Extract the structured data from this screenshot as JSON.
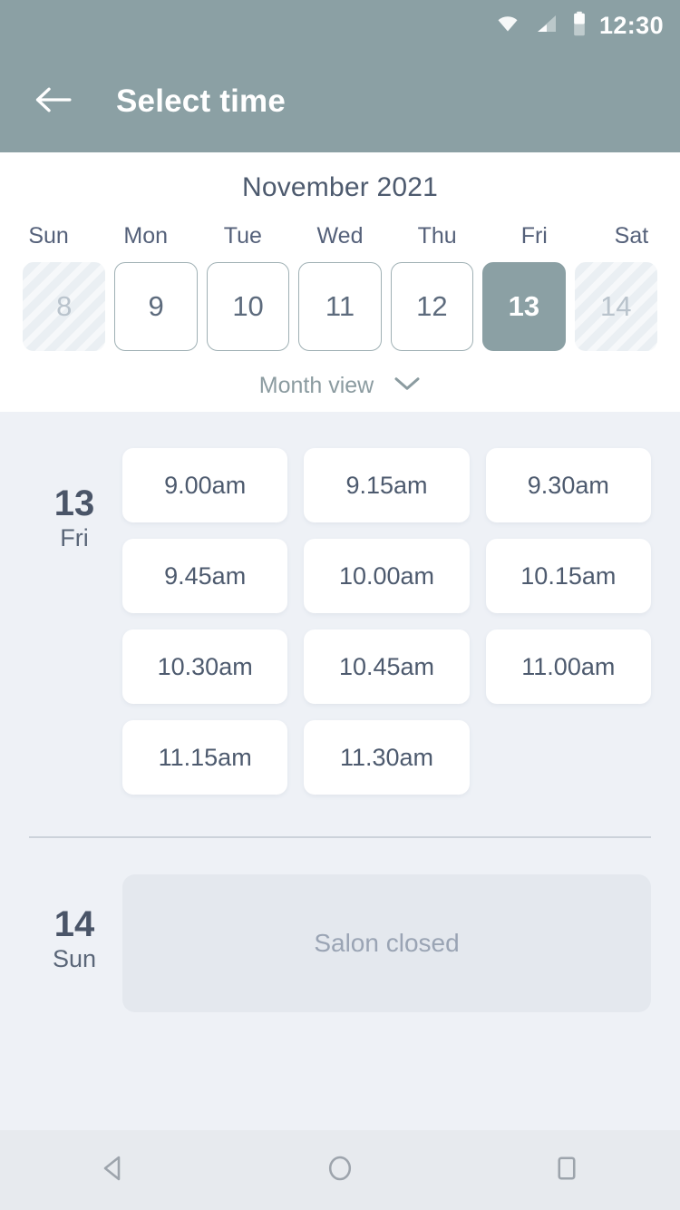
{
  "status_bar": {
    "time": "12:30",
    "icons": [
      "wifi-icon",
      "signal-icon",
      "battery-icon"
    ]
  },
  "app_bar": {
    "back_icon": "back-arrow-icon",
    "title": "Select time"
  },
  "calendar": {
    "month_title": "November 2021",
    "day_of_week_headers": [
      "Sun",
      "Mon",
      "Tue",
      "Wed",
      "Thu",
      "Fri",
      "Sat"
    ],
    "days": [
      {
        "num": "8",
        "state": "disabled"
      },
      {
        "num": "9",
        "state": "enabled"
      },
      {
        "num": "10",
        "state": "enabled"
      },
      {
        "num": "11",
        "state": "enabled"
      },
      {
        "num": "12",
        "state": "enabled"
      },
      {
        "num": "13",
        "state": "selected"
      },
      {
        "num": "14",
        "state": "disabled"
      }
    ],
    "month_view_label": "Month view",
    "month_view_icon": "chevron-down-icon"
  },
  "day_groups": [
    {
      "day_number": "13",
      "day_name": "Fri",
      "slots": [
        "9.00am",
        "9.15am",
        "9.30am",
        "9.45am",
        "10.00am",
        "10.15am",
        "10.30am",
        "10.45am",
        "11.00am",
        "11.15am",
        "11.30am"
      ]
    },
    {
      "day_number": "14",
      "day_name": "Sun",
      "closed_message": "Salon closed"
    }
  ],
  "nav_bar": {
    "back_icon": "nav-back-triangle-icon",
    "home_icon": "nav-home-circle-icon",
    "recents_icon": "nav-recents-square-icon"
  },
  "colors": {
    "accent": "#8ba0a4",
    "background": "#eef1f6",
    "card": "#ffffff",
    "text_primary": "#4d5a6e",
    "text_muted": "#9aa4b4",
    "closed_card": "#e4e8ee"
  }
}
